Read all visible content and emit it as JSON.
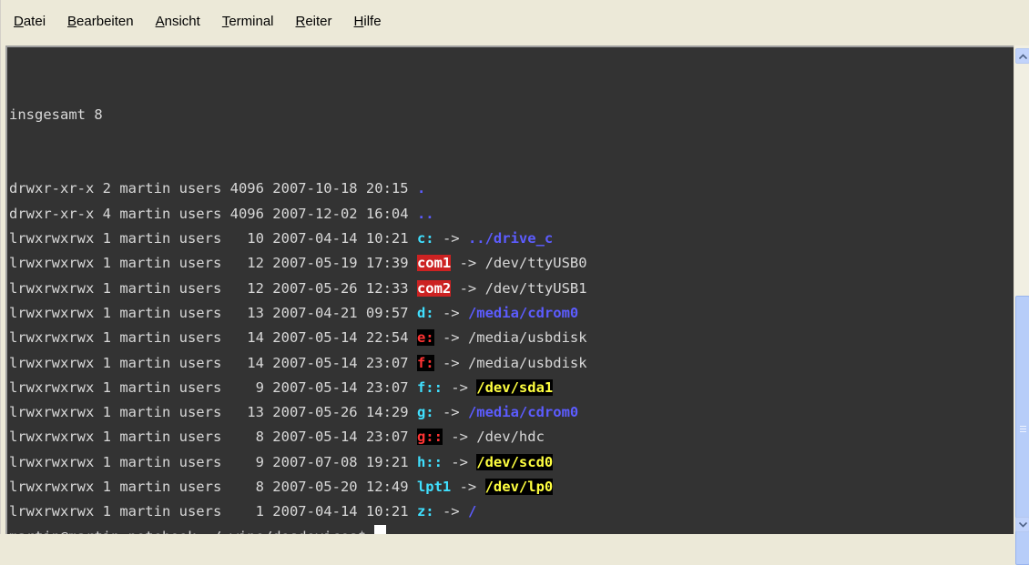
{
  "menubar": {
    "items": [
      {
        "acc": "D",
        "rest": "atei"
      },
      {
        "acc": "B",
        "rest": "earbeiten"
      },
      {
        "acc": "A",
        "rest": "nsicht"
      },
      {
        "acc": "T",
        "rest": "erminal"
      },
      {
        "acc": "R",
        "rest": "eiter"
      },
      {
        "acc": "H",
        "rest": "ilfe"
      }
    ]
  },
  "terminal": {
    "total": "insgesamt 8",
    "entries": [
      {
        "meta": "drwxr-xr-x 2 martin users 4096 2007-10-18 20:15 ",
        "name": ".",
        "name_style": "blue",
        "target": ""
      },
      {
        "meta": "drwxr-xr-x 4 martin users 4096 2007-12-02 16:04 ",
        "name": "..",
        "name_style": "blue",
        "target": ""
      },
      {
        "meta": "lrwxrwxrwx 1 martin users   10 2007-04-14 10:21 ",
        "name": "c:",
        "name_style": "cyan",
        "target": "../drive_c",
        "target_style": "blue"
      },
      {
        "meta": "lrwxrwxrwx 1 martin users   12 2007-05-19 17:39 ",
        "name": "com1",
        "name_style": "red",
        "target": "/dev/ttyUSB0",
        "target_style": "plain"
      },
      {
        "meta": "lrwxrwxrwx 1 martin users   12 2007-05-26 12:33 ",
        "name": "com2",
        "name_style": "red",
        "target": "/dev/ttyUSB1",
        "target_style": "plain"
      },
      {
        "meta": "lrwxrwxrwx 1 martin users   13 2007-04-21 09:57 ",
        "name": "d:",
        "name_style": "cyan",
        "target": "/media/cdrom0",
        "target_style": "blue"
      },
      {
        "meta": "lrwxrwxrwx 1 martin users   14 2007-05-14 22:54 ",
        "name": "e:",
        "name_style": "redblk",
        "target": "/media/usbdisk",
        "target_style": "plain"
      },
      {
        "meta": "lrwxrwxrwx 1 martin users   14 2007-05-14 23:07 ",
        "name": "f:",
        "name_style": "redblk",
        "target": "/media/usbdisk",
        "target_style": "plain"
      },
      {
        "meta": "lrwxrwxrwx 1 martin users    9 2007-05-14 23:07 ",
        "name": "f::",
        "name_style": "cyan",
        "target": "/dev/sda1",
        "target_style": "yellow"
      },
      {
        "meta": "lrwxrwxrwx 1 martin users   13 2007-05-26 14:29 ",
        "name": "g:",
        "name_style": "cyan",
        "target": "/media/cdrom0",
        "target_style": "blue"
      },
      {
        "meta": "lrwxrwxrwx 1 martin users    8 2007-05-14 23:07 ",
        "name": "g::",
        "name_style": "redblk",
        "target": "/dev/hdc",
        "target_style": "plain"
      },
      {
        "meta": "lrwxrwxrwx 1 martin users    9 2007-07-08 19:21 ",
        "name": "h::",
        "name_style": "cyan",
        "target": "/dev/scd0",
        "target_style": "yellow"
      },
      {
        "meta": "lrwxrwxrwx 1 martin users    8 2007-05-20 12:49 ",
        "name": "lpt1",
        "name_style": "cyan",
        "target": "/dev/lp0",
        "target_style": "yellow"
      },
      {
        "meta": "lrwxrwxrwx 1 martin users    1 2007-04-14 10:21 ",
        "name": "z:",
        "name_style": "cyan",
        "target": "/",
        "target_style": "blue"
      }
    ],
    "prompt": "martin@martin-notebook:~/.wine/dosdevices$ "
  },
  "scrollbar": {
    "up_icon": "arrow-up-icon",
    "down_icon": "arrow-down-icon"
  },
  "colors": {
    "terminal_bg": "#333333",
    "text": "#d8d8d8",
    "cyan": "#40e0ff",
    "blue": "#5c5cff",
    "red_bg": "#cc2222",
    "yellow": "#ffff40"
  }
}
